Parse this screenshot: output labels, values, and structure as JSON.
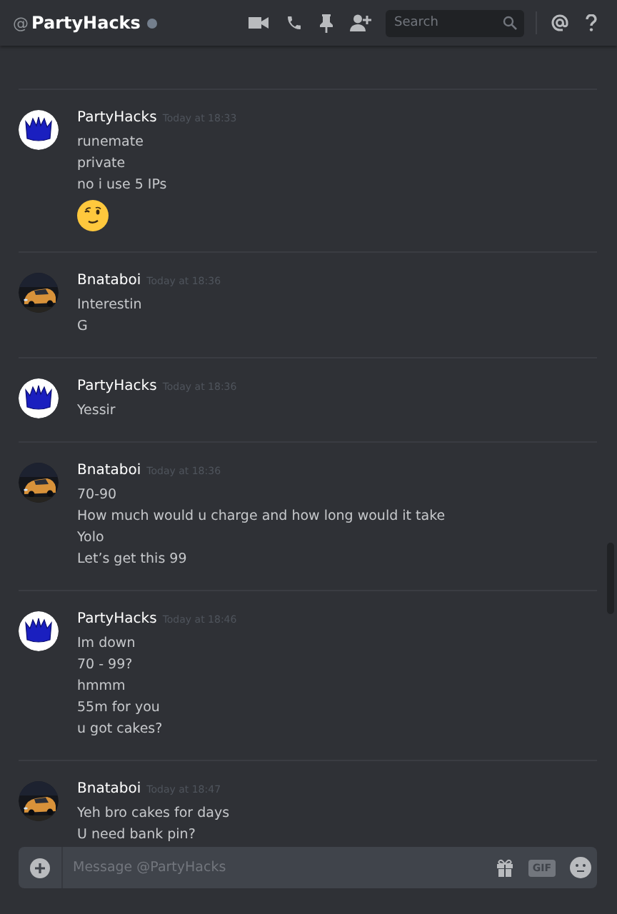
{
  "header": {
    "at_sign": "@",
    "title": "PartyHacks",
    "search": {
      "placeholder": "Search"
    }
  },
  "messages": [
    {
      "author": "PartyHacks",
      "kind": "crown",
      "time": "Today at 18:33",
      "lines": [
        "runemate",
        "private",
        "no i use 5 IPs"
      ],
      "emoji": true
    },
    {
      "author": "Bnataboi",
      "kind": "picture",
      "time": "Today at 18:36",
      "lines": [
        "Interestin",
        "G"
      ],
      "emoji": false
    },
    {
      "author": "PartyHacks",
      "kind": "crown",
      "time": "Today at 18:36",
      "lines": [
        "Yessir"
      ],
      "emoji": false
    },
    {
      "author": "Bnataboi",
      "kind": "picture",
      "time": "Today at 18:36",
      "lines": [
        "70-90",
        "How much would u charge and how long would it take",
        "Yolo",
        "Let’s get this 99"
      ],
      "emoji": false
    },
    {
      "author": "PartyHacks",
      "kind": "crown",
      "time": "Today at 18:46",
      "lines": [
        "Im down",
        "70 - 99?",
        "hmmm",
        "55m for you",
        "u got cakes?"
      ],
      "emoji": false
    },
    {
      "author": "Bnataboi",
      "kind": "picture",
      "time": "Today at 18:47",
      "lines": [
        "Yeh bro cakes for days",
        "U need bank pin?"
      ],
      "emoji": false
    }
  ],
  "composer": {
    "placeholder": "Message @PartyHacks",
    "gif_label": "GIF"
  }
}
